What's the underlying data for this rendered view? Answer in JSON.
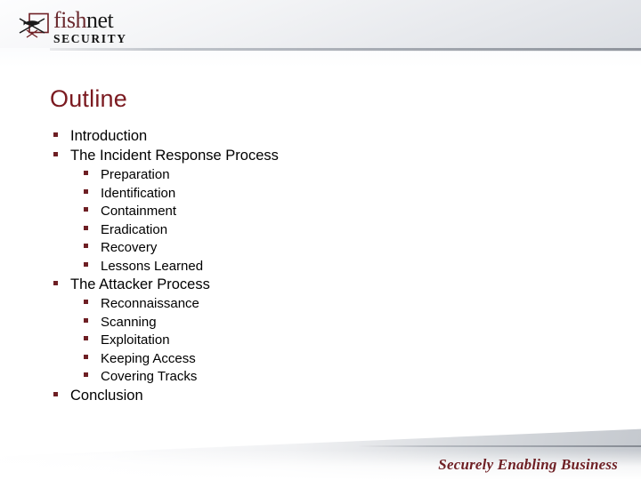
{
  "slide": {
    "title": "Outline",
    "title_color": "#7b1a20",
    "background_color": "#ffffff",
    "accent_color": "#6e1f24",
    "body_text_color": "#000000"
  },
  "header": {
    "logo": {
      "icon": "fish-in-net-icon",
      "wordmark_part1": "fish",
      "wordmark_part2": "net",
      "wordmark_sub": "SECURITY",
      "wordmark_part1_color": "#6b2a2f",
      "wordmark_part2_color": "#1a1a1a"
    }
  },
  "outline": [
    {
      "level": 1,
      "bullet": "square-bullet",
      "label": "Introduction"
    },
    {
      "level": 1,
      "bullet": "square-bullet",
      "label": "The Incident Response Process"
    },
    {
      "level": 2,
      "bullet": "square-bullet",
      "label": "Preparation"
    },
    {
      "level": 2,
      "bullet": "square-bullet",
      "label": "Identification"
    },
    {
      "level": 2,
      "bullet": "square-bullet",
      "label": "Containment"
    },
    {
      "level": 2,
      "bullet": "square-bullet",
      "label": "Eradication"
    },
    {
      "level": 2,
      "bullet": "square-bullet",
      "label": "Recovery"
    },
    {
      "level": 2,
      "bullet": "square-bullet",
      "label": "Lessons Learned"
    },
    {
      "level": 1,
      "bullet": "square-bullet",
      "label": "The Attacker Process"
    },
    {
      "level": 2,
      "bullet": "square-bullet",
      "label": "Reconnaissance"
    },
    {
      "level": 2,
      "bullet": "square-bullet",
      "label": "Scanning"
    },
    {
      "level": 2,
      "bullet": "square-bullet",
      "label": "Exploitation"
    },
    {
      "level": 2,
      "bullet": "square-bullet",
      "label": "Keeping Access"
    },
    {
      "level": 2,
      "bullet": "square-bullet",
      "label": "Covering Tracks"
    },
    {
      "level": 1,
      "bullet": "square-bullet",
      "label": "Conclusion"
    }
  ],
  "footer": {
    "tagline": "Securely Enabling Business",
    "tagline_color": "#6e1f24"
  }
}
